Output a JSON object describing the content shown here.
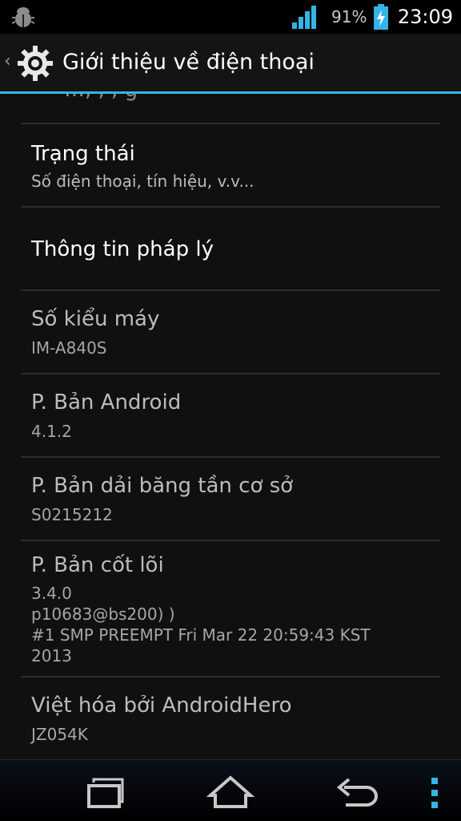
{
  "status_bar": {
    "battery_percent": "91%",
    "battery_level": 0.91,
    "signal_bars": 4,
    "time": "23:09",
    "icons": [
      "debug-icon",
      "signal-icon",
      "battery-charging-icon"
    ]
  },
  "action_bar": {
    "title": "Giới thiệu về điện thoại",
    "icons": [
      "up-caret-icon",
      "settings-gear-icon"
    ]
  },
  "list": {
    "partial_text": "…, , , g",
    "items": [
      {
        "title": "Trạng thái",
        "summary": "Số điện thoại, tín hiệu, v.v..."
      },
      {
        "title": "Thông tin pháp lý"
      },
      {
        "title": "Số kiểu máy",
        "summary": "IM-A840S"
      },
      {
        "title": "P. Bản Android",
        "summary": "4.1.2"
      },
      {
        "title": "P. Bản dải băng tần cơ sở",
        "summary": "S0215212"
      },
      {
        "title": "P. Bản cốt lõi",
        "summary_lines": [
          "3.4.0",
          "p10683@bs200) )",
          "#1 SMP PREEMPT Fri Mar 22 20:59:43 KST",
          "2013"
        ]
      },
      {
        "title": "Việt hóa bởi AndroidHero",
        "summary": "JZ054K"
      }
    ]
  },
  "nav_bar": {
    "icons": [
      "recent-apps-icon",
      "home-icon",
      "back-icon",
      "overflow-menu-icon"
    ]
  },
  "colors": {
    "accent": "#33b5e5",
    "background": "#101010",
    "text_primary": "#ffffff",
    "text_secondary": "#bcbcbc"
  }
}
